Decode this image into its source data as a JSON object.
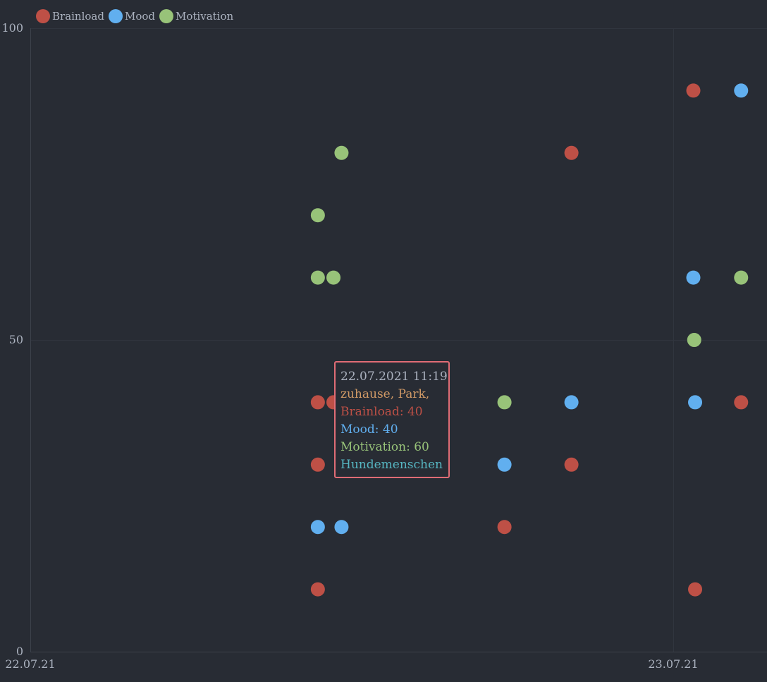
{
  "colors": {
    "background": "#282c34",
    "grid": "#30353e",
    "axis": "#3c414b",
    "text": "#abb2bf",
    "brainload": "#be5046",
    "mood": "#61afef",
    "motivation": "#98c379",
    "tooltip_border": "#e06c75",
    "tooltip_places": "#d19a66",
    "tooltip_tags": "#56b6c2"
  },
  "legend": [
    {
      "label": "Brainload",
      "color": "#be5046"
    },
    {
      "label": "Mood",
      "color": "#61afef"
    },
    {
      "label": "Motivation",
      "color": "#98c379"
    }
  ],
  "tooltip": {
    "date": "22.07.2021 11:19",
    "places": "zuhause, Park,",
    "brainload": "Brainload: 40",
    "mood": "Mood: 40",
    "motivation": "Motivation: 60",
    "tags": "Hundemenschen"
  },
  "chart_data": {
    "type": "scatter",
    "xlabel": "",
    "ylabel": "",
    "ylim": [
      0,
      100
    ],
    "yticks": [
      0,
      50,
      100
    ],
    "xlim": [
      "2021-07-22T00:00",
      "2021-07-23T03:30"
    ],
    "xticks": [
      {
        "value": "2021-07-22T00:00",
        "label": "22.07.21"
      },
      {
        "value": "2021-07-23T00:00",
        "label": "23.07.21"
      }
    ],
    "grid": true,
    "legend_position": "top-left",
    "series": [
      {
        "name": "Brainload",
        "color": "#be5046",
        "points": [
          {
            "x": "2021-07-22T10:44",
            "y": 40
          },
          {
            "x": "2021-07-22T11:19",
            "y": 40
          },
          {
            "x": "2021-07-22T10:44",
            "y": 30
          },
          {
            "x": "2021-07-22T10:44",
            "y": 10
          },
          {
            "x": "2021-07-22T17:42",
            "y": 20
          },
          {
            "x": "2021-07-22T20:12",
            "y": 80
          },
          {
            "x": "2021-07-22T20:12",
            "y": 30
          },
          {
            "x": "2021-07-23T00:45",
            "y": 90
          },
          {
            "x": "2021-07-23T00:49",
            "y": 10
          },
          {
            "x": "2021-07-23T02:32",
            "y": 40
          }
        ]
      },
      {
        "name": "Mood",
        "color": "#61afef",
        "points": [
          {
            "x": "2021-07-22T10:44",
            "y": 20
          },
          {
            "x": "2021-07-22T11:37",
            "y": 20
          },
          {
            "x": "2021-07-22T17:42",
            "y": 30
          },
          {
            "x": "2021-07-22T20:12",
            "y": 40
          },
          {
            "x": "2021-07-23T00:45",
            "y": 60
          },
          {
            "x": "2021-07-23T00:49",
            "y": 40
          },
          {
            "x": "2021-07-23T02:32",
            "y": 90
          }
        ]
      },
      {
        "name": "Motivation",
        "color": "#98c379",
        "points": [
          {
            "x": "2021-07-22T10:44",
            "y": 70
          },
          {
            "x": "2021-07-22T10:44",
            "y": 60
          },
          {
            "x": "2021-07-22T11:19",
            "y": 60
          },
          {
            "x": "2021-07-22T11:37",
            "y": 80
          },
          {
            "x": "2021-07-22T17:42",
            "y": 40
          },
          {
            "x": "2021-07-23T00:47",
            "y": 50
          },
          {
            "x": "2021-07-23T02:32",
            "y": 60
          }
        ]
      }
    ]
  }
}
